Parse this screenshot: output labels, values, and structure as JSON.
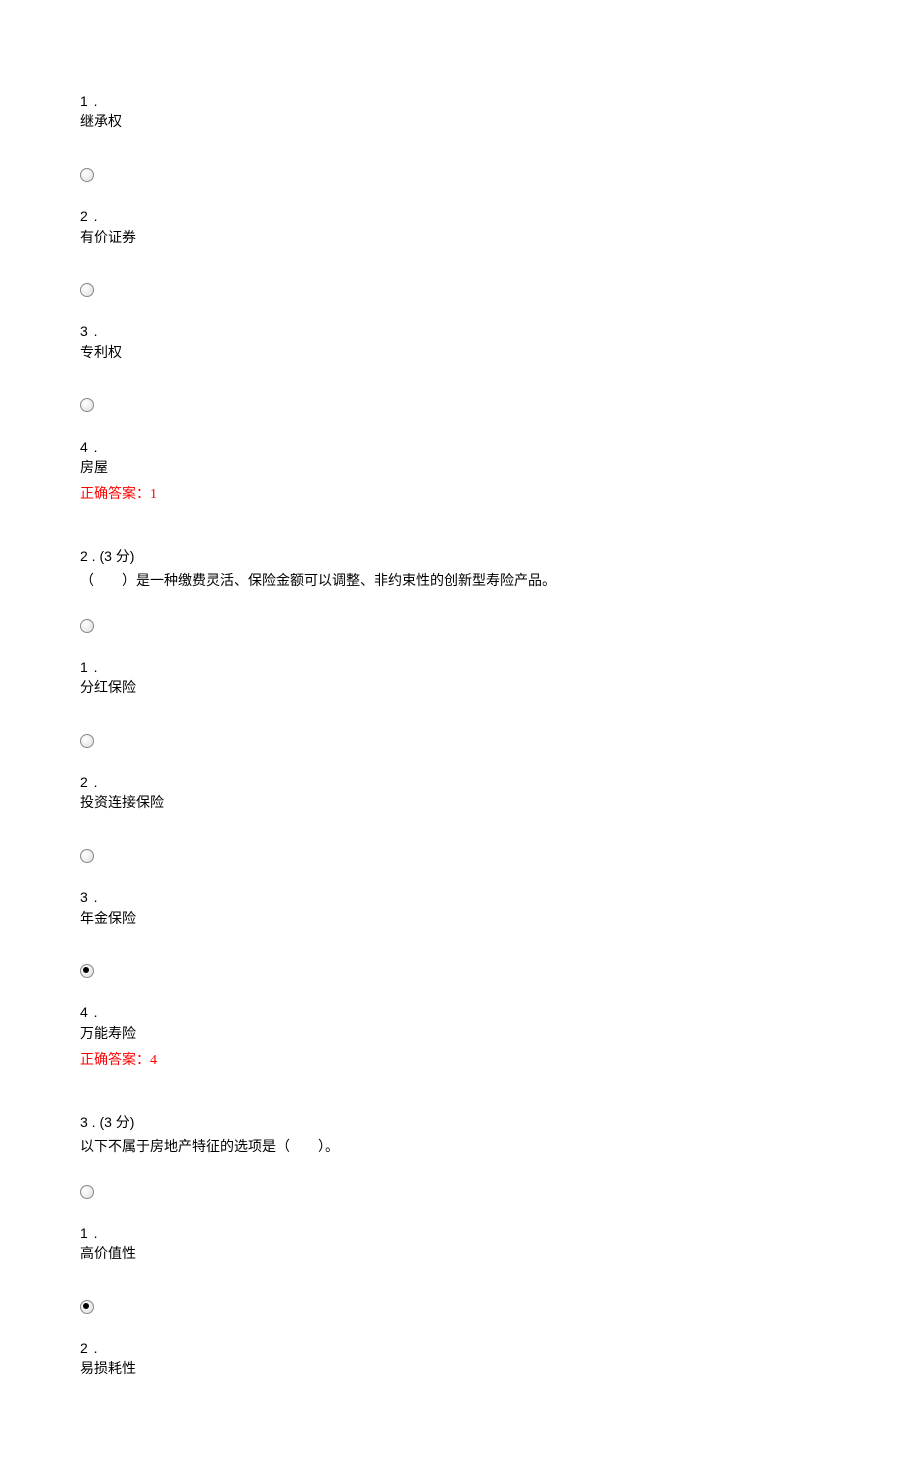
{
  "q1": {
    "opt1_num": "1 .",
    "opt1_text": "继承权",
    "opt2_num": "2 .",
    "opt2_text": "有价证券",
    "opt3_num": "3 .",
    "opt3_text": "专利权",
    "opt4_num": "4 .",
    "opt4_text": "房屋",
    "correct": "正确答案：1"
  },
  "q2": {
    "header": "2 . (3 分)",
    "text": "（　　）是一种缴费灵活、保险金额可以调整、非约束性的创新型寿险产品。",
    "opt1_num": "1 .",
    "opt1_text": "分红保险",
    "opt2_num": "2 .",
    "opt2_text": "投资连接保险",
    "opt3_num": "3 .",
    "opt3_text": "年金保险",
    "opt4_num": "4 .",
    "opt4_text": "万能寿险",
    "correct": "正确答案：4"
  },
  "q3": {
    "header": "3 . (3 分)",
    "text": "以下不属于房地产特征的选项是（　　）。",
    "opt1_num": "1 .",
    "opt1_text": "高价值性",
    "opt2_num": "2 .",
    "opt2_text": "易损耗性"
  }
}
